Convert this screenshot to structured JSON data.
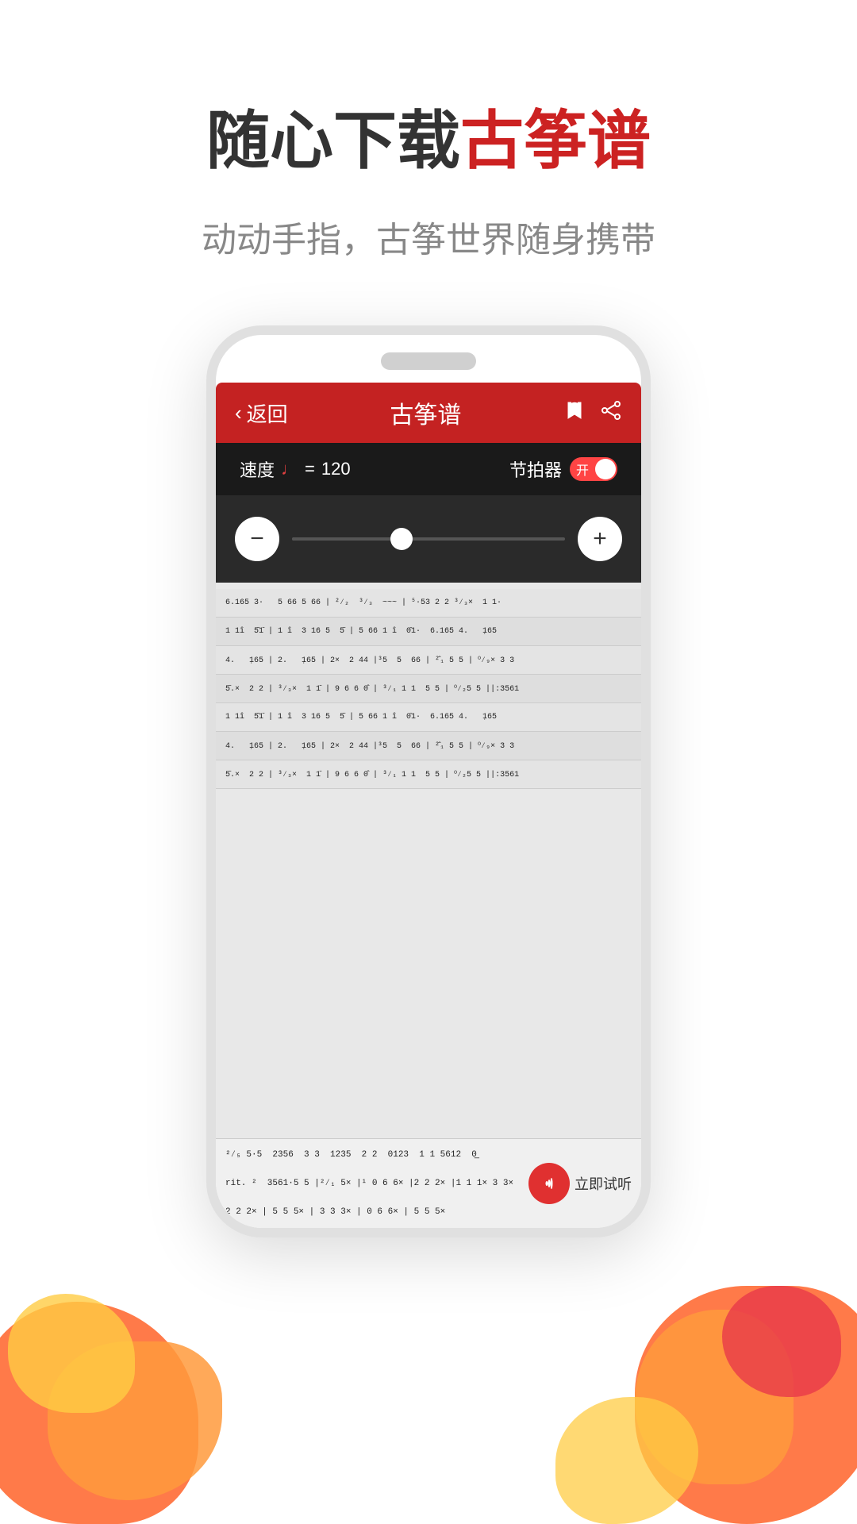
{
  "hero": {
    "title_prefix": "随心下载",
    "title_suffix": "古筝谱",
    "subtitle": "动动手指，古筝世界随身携带"
  },
  "app": {
    "header": {
      "back_label": "返回",
      "title": "古筝谱"
    },
    "tempo_bar": {
      "speed_label": "速度",
      "note_symbol": "♩",
      "equals": "=",
      "bpm": "120",
      "metronome_label": "节拍器",
      "toggle_on_label": "开"
    },
    "slider": {
      "minus_label": "−",
      "plus_label": "+"
    },
    "listen": {
      "button_label": "立即试听"
    },
    "sheet_rows": [
      "6.165  3·      5  66  5 66  |  ²⁄₂    ³⁄₃    ~~~  |  ⁵·53  2 2  ³⁄₃ ×   1 1·",
      "1  1̈î   5̄ 1̄  |  1 î   3 16  5    5̄   |  5 66  1 î   0̄1·   6.165  4.    1̣65",
      "4.    1̣65  |  2.     1̣65  |  2 ×   2 44  |  ³5   5   66  |  ²̂₁   5 5  |  ⁰⁄₉×   3 3",
      "5̄.×    2 2  |  ³⁄₃ ×   1  1̄   |  9 6   6 0̂  |  ³⁄₁   1 1   5 5  |  ⁰⁄₂5  5||:3561",
      "1  1̈î   5̄ 1̄  |  1 î   3 16  5    5̄   |  5 66  1 î   0̄1·   6.165  4.    1̣65",
      "4.    1̣65  |  2.     1̣65  |  2 ×   2 44  |  ³5   5   66  |  ²̂₁   5 5  |  ⁰⁄₉×   3 3",
      "5̄.×    2 2  |  ³⁄₃ ×   1  1̄   |  9 6   6 0̂  |  ³⁄₁   1 1   5 5  |  ⁰⁄₂5  5||:3561",
      "²⁄₅  5·5   2356   3 3   1235   2 2   0123   1 1  5612   0",
      "rit.  ²  3561·5 5  |  ²⁄₁  5 ×   |  ¹  0 6  6× |  2 2  2 ×  |  1 1   1 ×   3 3×",
      "2 2   2 ×  |  5 5   5 ×  |  3 3   3 ×  |  0 6   6 ×  |  5 5   5 ×"
    ]
  },
  "colors": {
    "header_red": "#c42222",
    "toggle_red": "#ff4444",
    "listen_red": "#e03030",
    "title_red": "#cc2222",
    "text_dark": "#333333",
    "text_gray": "#888888",
    "blob_orange": "#ff6b35",
    "blob_light_orange": "#ff9a3c",
    "blob_yellow": "#ffcc44",
    "blob_red": "#e8394a"
  }
}
